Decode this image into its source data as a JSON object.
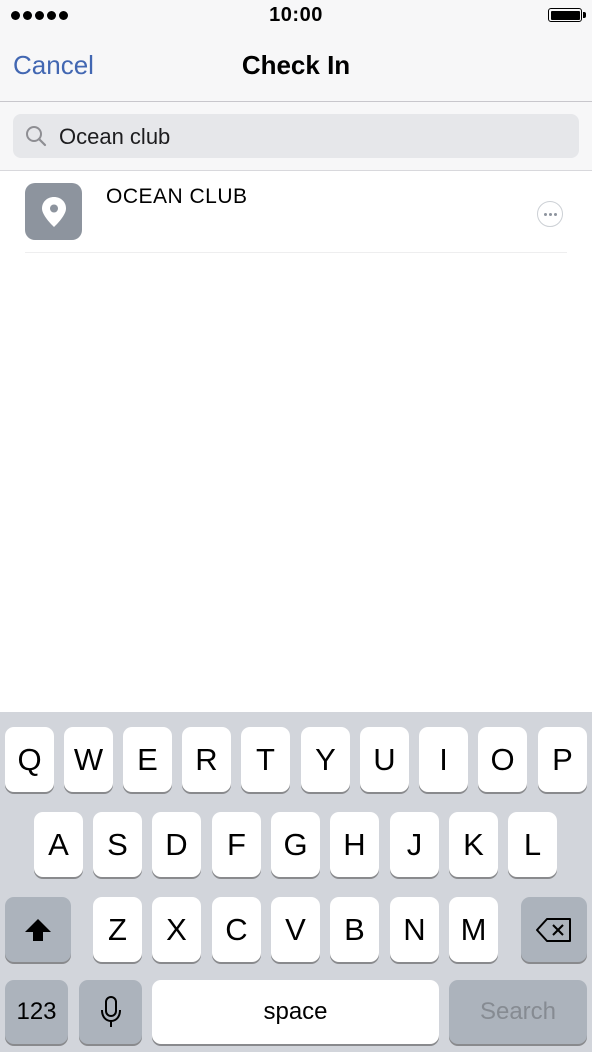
{
  "status_bar": {
    "time": "10:00"
  },
  "navbar": {
    "cancel_label": "Cancel",
    "title": "Check In"
  },
  "search": {
    "value": "Ocean club"
  },
  "results": [
    {
      "name": "OCEAN CLUB"
    }
  ],
  "keyboard": {
    "row1": [
      "Q",
      "W",
      "E",
      "R",
      "T",
      "Y",
      "U",
      "I",
      "O",
      "P"
    ],
    "row2": [
      "A",
      "S",
      "D",
      "F",
      "G",
      "H",
      "J",
      "K",
      "L"
    ],
    "row3": [
      "Z",
      "X",
      "C",
      "V",
      "B",
      "N",
      "M"
    ],
    "numbers_label": "123",
    "space_label": "space",
    "return_label": "Search"
  },
  "colors": {
    "accent": "#4267b2",
    "pin_tile": "#8d949e",
    "keyboard_bg": "#d2d5db"
  }
}
